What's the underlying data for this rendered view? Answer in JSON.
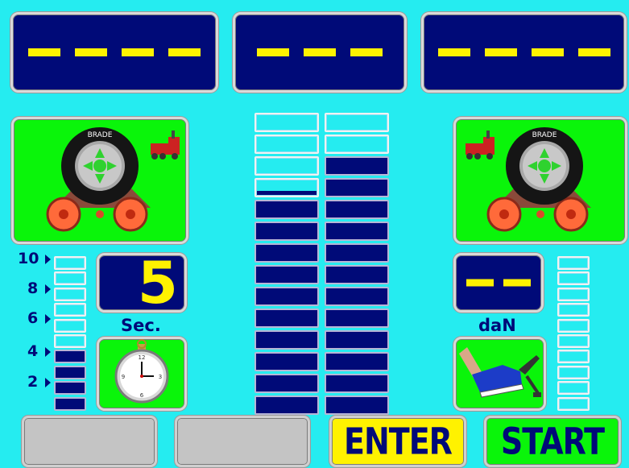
{
  "colors": {
    "background": "#25ecf0",
    "panel_navy": "#000a78",
    "panel_green": "#0af50a",
    "display_yellow": "#fff200",
    "button_grey": "#c4c4c4"
  },
  "displays": {
    "top_left": "----",
    "top_center": "---",
    "top_right": "----",
    "timer_value": "5",
    "force_value": "--"
  },
  "labels": {
    "timer_unit": "Sec.",
    "force_unit": "daN"
  },
  "left_scale": {
    "ticks": [
      "10",
      "8",
      "6",
      "4",
      "2"
    ],
    "level_fraction": 0.4
  },
  "center_bars": {
    "left_level_fraction": 0.72,
    "right_level_fraction": 0.83
  },
  "right_scale": {
    "level_fraction": 0.0
  },
  "icons": {
    "left_wheel": "tire-wheel-rollers-icon",
    "right_wheel": "tire-wheel-rollers-icon",
    "timer": "stopwatch-icon",
    "pedal": "brake-pedal-icon",
    "truck": "truck-icon"
  },
  "buttons": {
    "soft1_label": "",
    "soft2_label": "",
    "enter_label": "ENTER",
    "start_label": "START"
  }
}
